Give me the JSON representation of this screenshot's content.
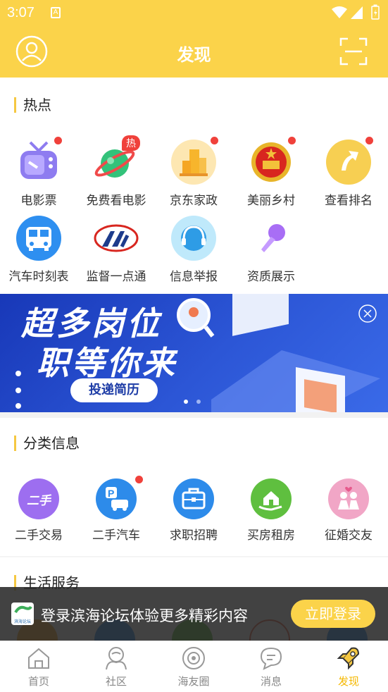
{
  "status": {
    "time": "3:07"
  },
  "header": {
    "title": "发现"
  },
  "hot": {
    "title": "热点",
    "items": [
      {
        "label": "电影票",
        "dot": true
      },
      {
        "label": "免费看电影",
        "badge": "热"
      },
      {
        "label": "京东家政",
        "dot": true
      },
      {
        "label": "美丽乡村",
        "dot": true
      },
      {
        "label": "查看排名",
        "dot": true
      },
      {
        "label": "汽车时刻表"
      },
      {
        "label": "监督一点通"
      },
      {
        "label": "信息举报"
      },
      {
        "label": "资质展示"
      }
    ]
  },
  "banner": {
    "line1": "超多岗位",
    "line2": "职等你来",
    "button": "投递简历"
  },
  "category": {
    "title": "分类信息",
    "items": [
      {
        "label": "二手交易",
        "icon_text": "二手"
      },
      {
        "label": "二手汽车",
        "dot": true
      },
      {
        "label": "求职招聘"
      },
      {
        "label": "买房租房"
      },
      {
        "label": "征婚交友"
      }
    ]
  },
  "life": {
    "title": "生活服务"
  },
  "login_bar": {
    "text": "登录滨海论坛体验更多精彩内容",
    "button": "立即登录",
    "logo_text": "滨海论坛"
  },
  "tabs": [
    {
      "label": "首页"
    },
    {
      "label": "社区"
    },
    {
      "label": "海友圈"
    },
    {
      "label": "消息"
    },
    {
      "label": "发现",
      "active": true
    }
  ],
  "colors": {
    "brand": "#fbd34a",
    "accent": "#f5b800",
    "red": "#f0413b"
  }
}
